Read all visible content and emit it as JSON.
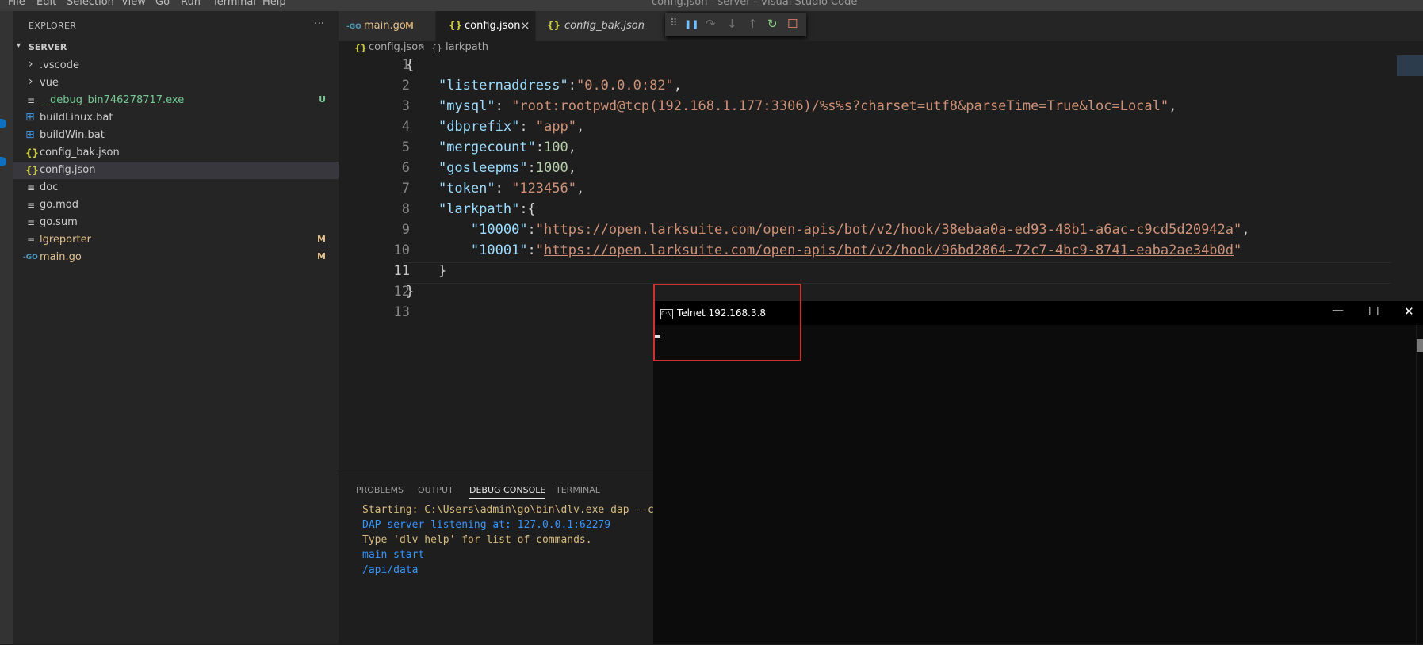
{
  "window": {
    "title": "config.json - server - Visual Studio Code"
  },
  "menu": [
    "File",
    "Edit",
    "Selection",
    "View",
    "Go",
    "Run",
    "Terminal",
    "Help"
  ],
  "sidebar": {
    "title": "EXPLORER",
    "more": "···",
    "root": "SERVER",
    "items": [
      {
        "label": ".vscode",
        "icon": "chevron-right-icon",
        "glyph": "›",
        "status": ""
      },
      {
        "label": "vue",
        "icon": "chevron-right-icon",
        "glyph": "›",
        "status": ""
      },
      {
        "label": "__debug_bin746278717.exe",
        "icon": "file-icon",
        "glyph": "≡",
        "status": "U"
      },
      {
        "label": "buildLinux.bat",
        "icon": "windows-icon",
        "glyph": "⊞",
        "status": ""
      },
      {
        "label": "buildWin.bat",
        "icon": "windows-icon",
        "glyph": "⊞",
        "status": ""
      },
      {
        "label": "config_bak.json",
        "icon": "json-icon",
        "glyph": "{}",
        "status": ""
      },
      {
        "label": "config.json",
        "icon": "json-icon",
        "glyph": "{}",
        "status": ""
      },
      {
        "label": "doc",
        "icon": "file-icon",
        "glyph": "≡",
        "status": ""
      },
      {
        "label": "go.mod",
        "icon": "file-icon",
        "glyph": "≡",
        "status": ""
      },
      {
        "label": "go.sum",
        "icon": "file-icon",
        "glyph": "≡",
        "status": ""
      },
      {
        "label": "lgreporter",
        "icon": "file-icon",
        "glyph": "≡",
        "status": "M"
      },
      {
        "label": "main.go",
        "icon": "go-icon",
        "glyph": "-GO",
        "status": "M"
      }
    ]
  },
  "tabs": [
    {
      "label": "main.go",
      "status": "M",
      "glyph": "-GO"
    },
    {
      "label": "config.json",
      "close": "×",
      "glyph": "{}"
    },
    {
      "label": "config_bak.json",
      "glyph": "{}"
    }
  ],
  "debug_toolbar": {
    "grip": "⠿",
    "pause": "❚❚",
    "step_over": "↷",
    "step_into": "↓",
    "step_out": "↑",
    "restart": "↻",
    "stop": "☐"
  },
  "breadcrumb": {
    "file": "config.json",
    "separator": "›",
    "path": "larkpath",
    "file_glyph": "{}",
    "path_glyph": "{}"
  },
  "editor": {
    "line_numbers": [
      "1",
      "2",
      "3",
      "4",
      "5",
      "6",
      "7",
      "8",
      "9",
      "10",
      "11",
      "12",
      "13"
    ],
    "lines": [
      [
        {
          "t": "{",
          "c": "p"
        }
      ],
      [
        {
          "t": "    ",
          "c": "p"
        },
        {
          "t": "\"listernaddress\"",
          "c": "k"
        },
        {
          "t": ":",
          "c": "p"
        },
        {
          "t": "\"0.0.0.0:82\"",
          "c": "s"
        },
        {
          "t": ",",
          "c": "p"
        }
      ],
      [
        {
          "t": "    ",
          "c": "p"
        },
        {
          "t": "\"mysql\"",
          "c": "k"
        },
        {
          "t": ": ",
          "c": "p"
        },
        {
          "t": "\"root:rootpwd@tcp(192.168.1.177:3306)/%s%s?charset=utf8&parseTime=True&loc=Local\"",
          "c": "s"
        },
        {
          "t": ",",
          "c": "p"
        }
      ],
      [
        {
          "t": "    ",
          "c": "p"
        },
        {
          "t": "\"dbprefix\"",
          "c": "k"
        },
        {
          "t": ": ",
          "c": "p"
        },
        {
          "t": "\"app\"",
          "c": "s"
        },
        {
          "t": ",",
          "c": "p"
        }
      ],
      [
        {
          "t": "    ",
          "c": "p"
        },
        {
          "t": "\"mergecount\"",
          "c": "k"
        },
        {
          "t": ":",
          "c": "p"
        },
        {
          "t": "100",
          "c": "n"
        },
        {
          "t": ",",
          "c": "p"
        }
      ],
      [
        {
          "t": "    ",
          "c": "p"
        },
        {
          "t": "\"gosleepms\"",
          "c": "k"
        },
        {
          "t": ":",
          "c": "p"
        },
        {
          "t": "1000",
          "c": "n"
        },
        {
          "t": ",",
          "c": "p"
        }
      ],
      [
        {
          "t": "    ",
          "c": "p"
        },
        {
          "t": "\"token\"",
          "c": "k"
        },
        {
          "t": ": ",
          "c": "p"
        },
        {
          "t": "\"123456\"",
          "c": "s"
        },
        {
          "t": ",",
          "c": "p"
        }
      ],
      [
        {
          "t": "    ",
          "c": "p"
        },
        {
          "t": "\"larkpath\"",
          "c": "k"
        },
        {
          "t": ":{",
          "c": "p"
        }
      ],
      [
        {
          "t": "        ",
          "c": "p"
        },
        {
          "t": "\"10000\"",
          "c": "k"
        },
        {
          "t": ":",
          "c": "p"
        },
        {
          "t": "\"",
          "c": "s"
        },
        {
          "t": "https://open.larksuite.com/open-apis/bot/v2/hook/38ebaa0a-ed93-48b1-a6ac-c9cd5d20942a",
          "c": "u"
        },
        {
          "t": "\"",
          "c": "s"
        },
        {
          "t": ",",
          "c": "p"
        }
      ],
      [
        {
          "t": "        ",
          "c": "p"
        },
        {
          "t": "\"10001\"",
          "c": "k"
        },
        {
          "t": ":",
          "c": "p"
        },
        {
          "t": "\"",
          "c": "s"
        },
        {
          "t": "https://open.larksuite.com/open-apis/bot/v2/hook/96bd2864-72c7-4bc9-8741-eaba2ae34b0d",
          "c": "u"
        },
        {
          "t": "\"",
          "c": "s"
        }
      ],
      [
        {
          "t": "    }",
          "c": "p"
        }
      ],
      [
        {
          "t": "}",
          "c": "p"
        }
      ],
      []
    ]
  },
  "panel": {
    "tabs": [
      "PROBLEMS",
      "OUTPUT",
      "DEBUG CONSOLE",
      "TERMINAL"
    ],
    "console": [
      {
        "text": "Starting: C:\\Users\\admin\\go\\bin\\dlv.exe dap --ch",
        "color": "#d7ba7d"
      },
      {
        "text": "DAP server listening at: 127.0.0.1:62279",
        "color": "#3794ff"
      },
      {
        "text": "Type 'dlv help' for list of commands.",
        "color": "#d7ba7d"
      },
      {
        "text": "main start",
        "color": "#3794ff"
      },
      {
        "text": "/api/data",
        "color": "#3794ff"
      }
    ]
  },
  "telnet": {
    "title": "Telnet 192.168.3.8",
    "icon_text": "C:\\",
    "minimize": "—",
    "maximize": "☐",
    "close": "✕"
  },
  "colors": {
    "accent": "#0e70c0",
    "highlight_box": "#d0302e",
    "modified": "#c5a16b",
    "untracked": "#73c991"
  }
}
